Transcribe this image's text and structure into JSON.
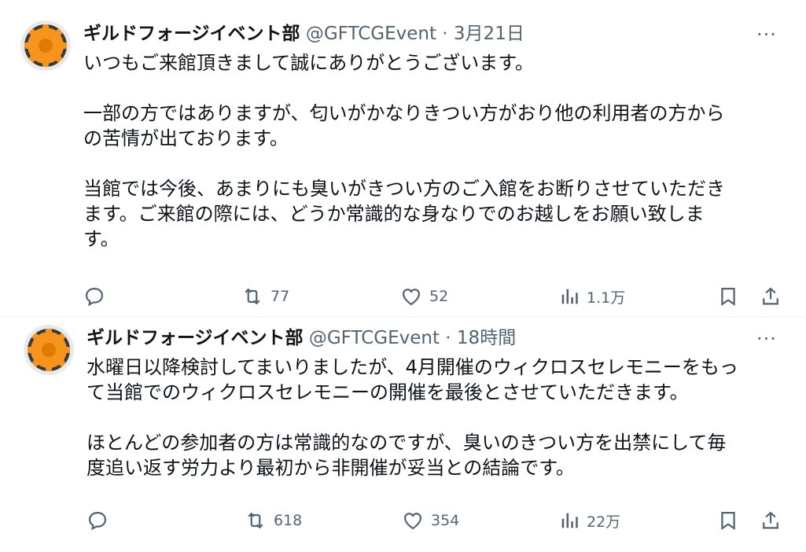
{
  "tweets": [
    {
      "name": "ギルドフォージイベント部",
      "handle": "@GFTCGEvent",
      "sep": "·",
      "time": "3月21日",
      "more": "···",
      "body": "いつもご来館頂きまして誠にありがとうございます。\n\n一部の方ではありますが、匂いがかなりきつい方がおり他の利用者の方から\nの苦情が出ております。\n\n当館では今後、あまりにも臭いがきつい方のご入館をお断りさせていただき\nます。ご来館の際には、どうか常識的な身なりでのお越しをお願い致しま\nす。",
      "reply_count": "",
      "retweets": "77",
      "likes": "52",
      "views": "1.1万"
    },
    {
      "name": "ギルドフォージイベント部",
      "handle": "@GFTCGEvent",
      "sep": "·",
      "time": "18時間",
      "more": "···",
      "body": "水曜日以降検討してまいりましたが、4月開催のウィクロスセレモニーをもっ\nて当館でのウィクロスセレモニーの開催を最後とさせていただきます。\n\nほとんどの参加者の方は常識的なのですが、臭いのきつい方を出禁にして毎\n度追い返す労力より最初から非開催が妥当との結論です。",
      "reply_count": "",
      "retweets": "618",
      "likes": "354",
      "views": "22万"
    }
  ],
  "icons": [
    "gear-avatar",
    "reply-icon",
    "retweet-icon",
    "like-icon",
    "views-icon",
    "bookmark-icon",
    "share-icon",
    "more-icon"
  ],
  "colors": {
    "avatar_orange": "#f7941d",
    "avatar_dark": "#3a3a3a",
    "text": "#0f1419",
    "muted": "#536471"
  }
}
